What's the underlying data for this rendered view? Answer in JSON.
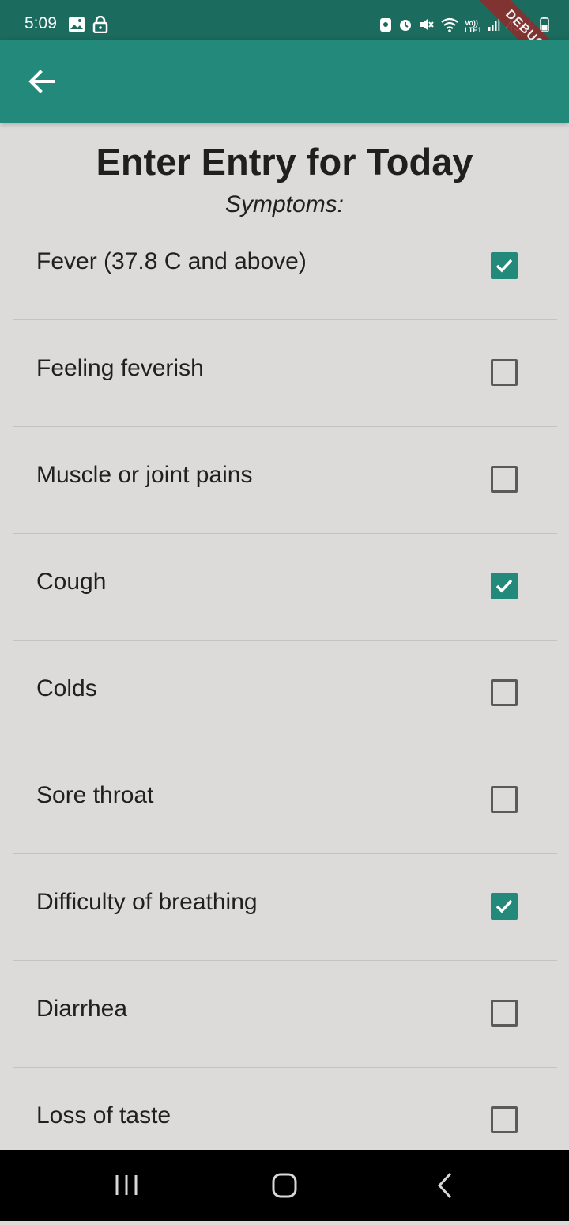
{
  "status_bar": {
    "time": "5:09",
    "battery": "45%",
    "network_label": "Vo)) LTE1",
    "icons": [
      "image-icon",
      "lock-icon",
      "battery-saver-icon",
      "alarm-icon",
      "mute-icon",
      "wifi-icon",
      "signal-icon",
      "battery-icon"
    ]
  },
  "debug_banner": {
    "label": "DEBUG"
  },
  "app_bar": {
    "back_icon": "arrow-back-icon",
    "color": "#23897a"
  },
  "page": {
    "title": "Enter Entry for Today",
    "subtitle": "Symptoms:"
  },
  "symptoms": [
    {
      "label": "Fever (37.8 C and above)",
      "checked": true
    },
    {
      "label": "Feeling feverish",
      "checked": false
    },
    {
      "label": "Muscle or joint pains",
      "checked": false
    },
    {
      "label": "Cough",
      "checked": true
    },
    {
      "label": "Colds",
      "checked": false
    },
    {
      "label": "Sore throat",
      "checked": false
    },
    {
      "label": "Difficulty of breathing",
      "checked": true
    },
    {
      "label": "Diarrhea",
      "checked": false
    },
    {
      "label": "Loss of taste",
      "checked": false
    }
  ],
  "nav_bar": {
    "buttons": [
      "recents-icon",
      "home-icon",
      "back-icon"
    ]
  }
}
